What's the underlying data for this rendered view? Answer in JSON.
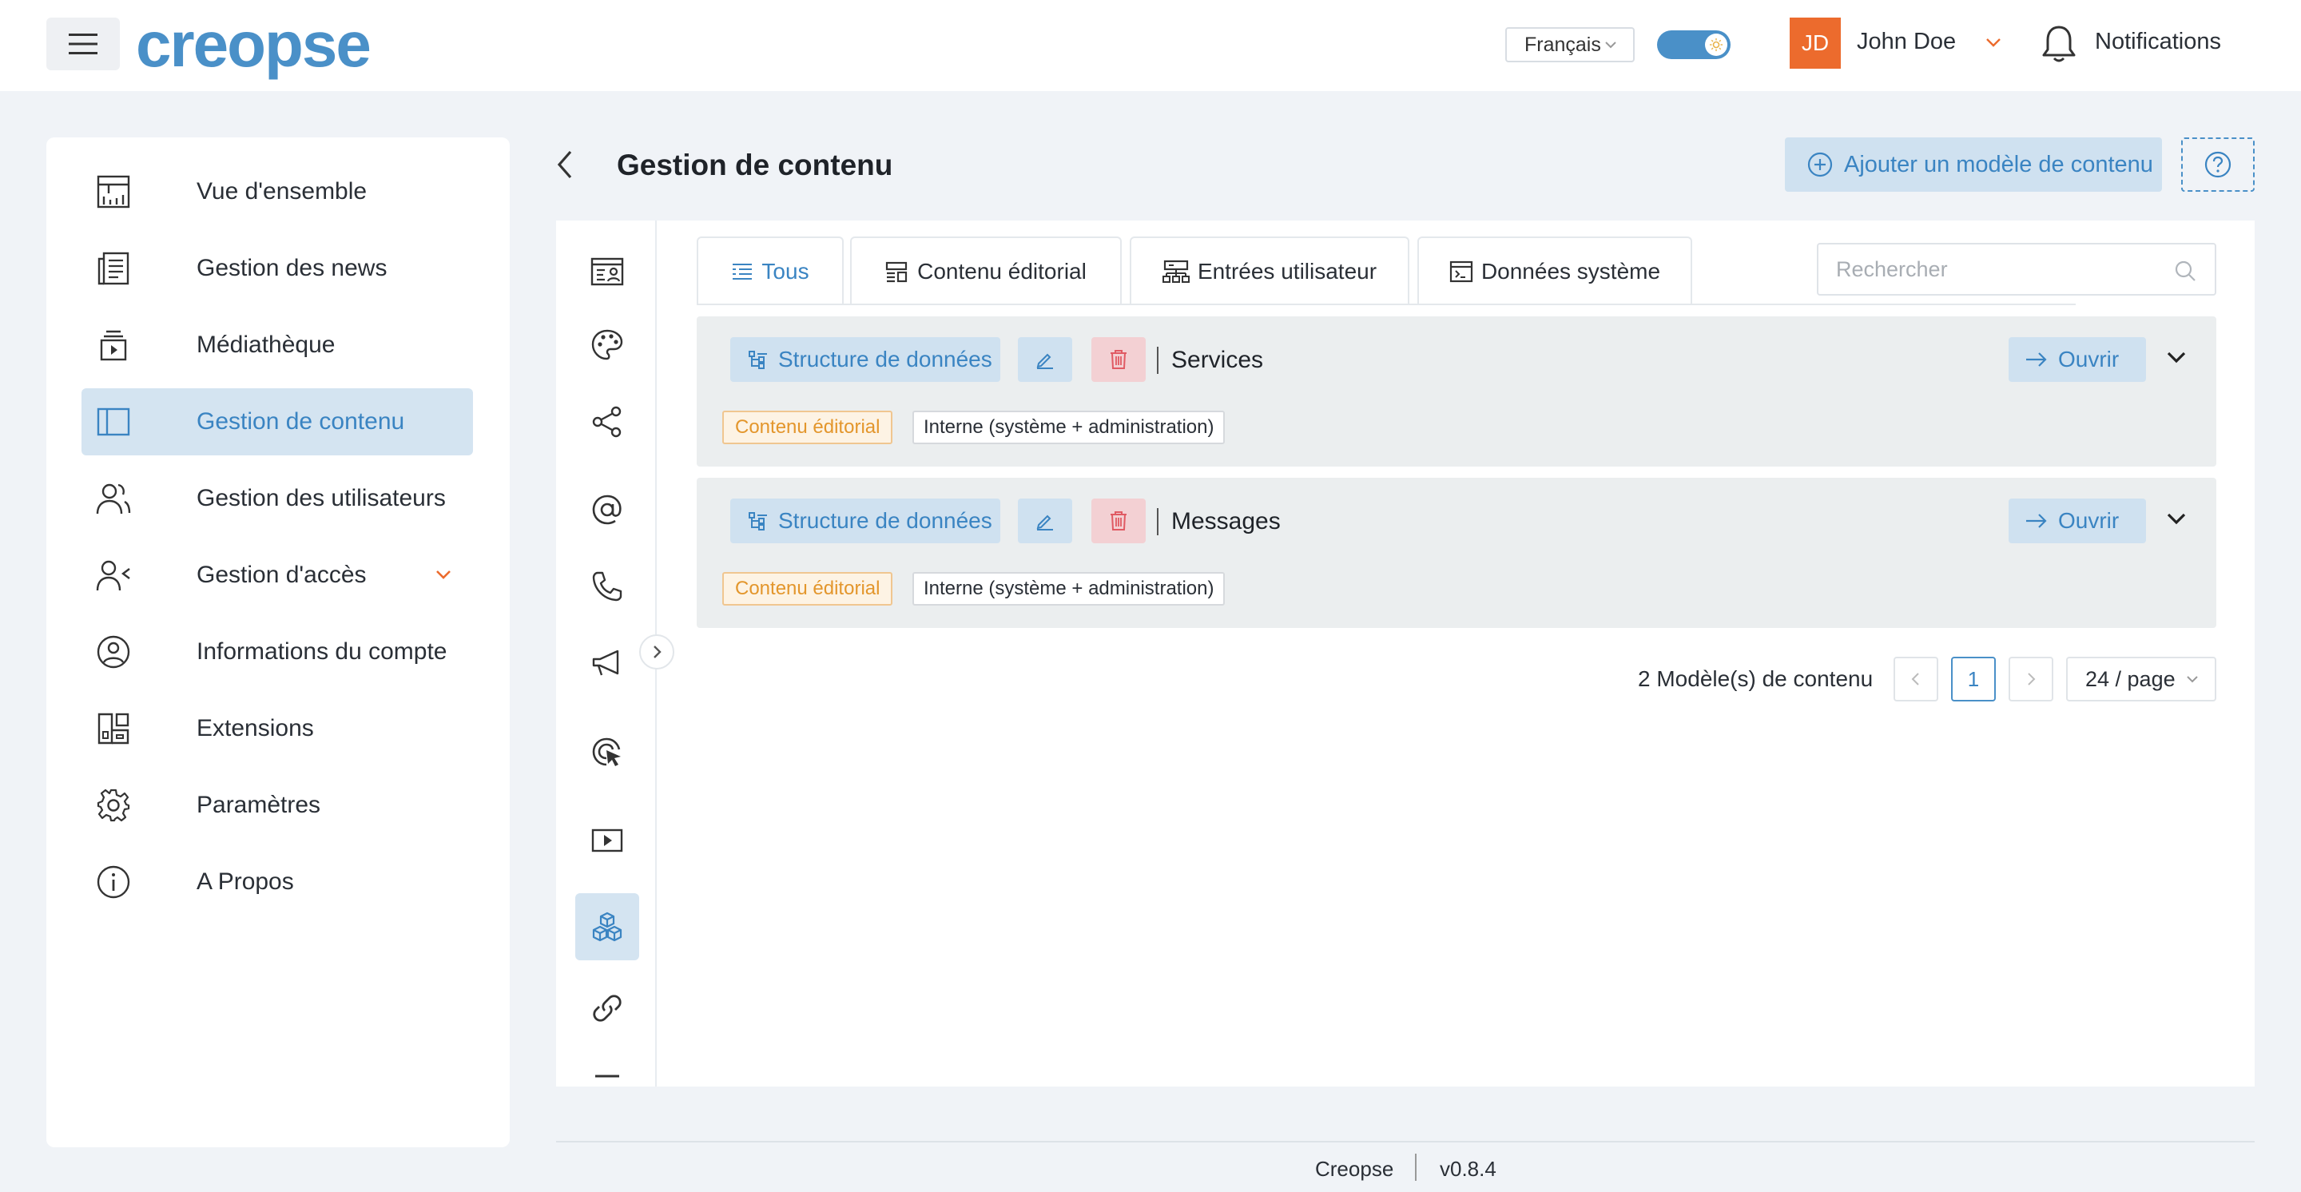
{
  "header": {
    "logo_text": "creopse",
    "language": "Français",
    "user": {
      "initials": "JD",
      "name": "John Doe"
    },
    "notifications_label": "Notifications"
  },
  "sidebar": {
    "items": [
      {
        "label": "Vue d'ensemble",
        "icon": "dashboard-icon"
      },
      {
        "label": "Gestion des news",
        "icon": "news-icon"
      },
      {
        "label": "Médiathèque",
        "icon": "media-library-icon"
      },
      {
        "label": "Gestion de contenu",
        "icon": "content-layout-icon",
        "active": true
      },
      {
        "label": "Gestion des utilisateurs",
        "icon": "users-icon"
      },
      {
        "label": "Gestion d'accès",
        "icon": "user-access-icon",
        "expandable": true
      },
      {
        "label": "Informations du compte",
        "icon": "account-circle-icon"
      },
      {
        "label": "Extensions",
        "icon": "extensions-icon"
      },
      {
        "label": "Paramètres",
        "icon": "gear-icon"
      },
      {
        "label": "A Propos",
        "icon": "info-icon"
      }
    ]
  },
  "page": {
    "title": "Gestion de contenu",
    "add_button_label": "Ajouter un modèle de contenu"
  },
  "tabs": [
    {
      "label": "Tous",
      "icon": "list-icon",
      "active": true
    },
    {
      "label": "Contenu éditorial",
      "icon": "editorial-icon"
    },
    {
      "label": "Entrées utilisateur",
      "icon": "user-input-icon"
    },
    {
      "label": "Données système",
      "icon": "system-data-icon"
    }
  ],
  "search": {
    "placeholder": "Rechercher",
    "value": ""
  },
  "models": [
    {
      "structure_label": "Structure de données",
      "name": "Services",
      "open_label": "Ouvrir",
      "category_tag": "Contenu éditorial",
      "scope_tag": "Interne (système + administration)"
    },
    {
      "structure_label": "Structure de données",
      "name": "Messages",
      "open_label": "Ouvrir",
      "category_tag": "Contenu éditorial",
      "scope_tag": "Interne (système + administration)"
    }
  ],
  "pagination": {
    "total_label": "2 Modèle(s) de contenu",
    "current_page": "1",
    "page_size": "24 / page"
  },
  "footer": {
    "brand": "Creopse",
    "version": "v0.8.4"
  },
  "colors": {
    "accent": "#4a90c8",
    "brand_orange": "#ec6b2d",
    "danger": "#e05a63",
    "tag_orange": "#e3962c"
  }
}
